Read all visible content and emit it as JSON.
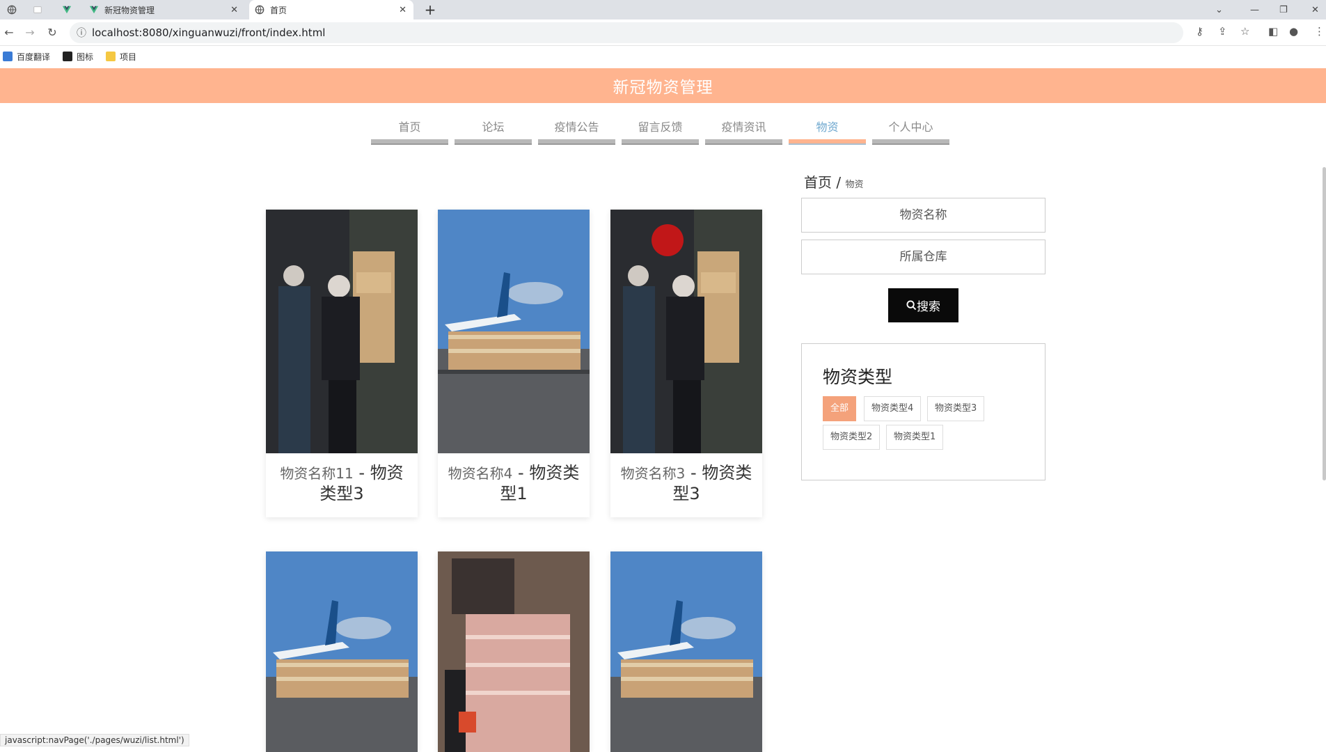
{
  "browser": {
    "tabs": [
      {
        "title": "",
        "active": false
      },
      {
        "title": "",
        "active": false
      },
      {
        "title": "新冠物资管理",
        "active": false
      },
      {
        "title": "首页",
        "active": true
      }
    ],
    "new_tab_symbol": "+",
    "url": "localhost:8080/xinguanwuzi/front/index.html",
    "bookmarks": [
      {
        "label": "百度翻译",
        "icon": "translate-icon",
        "color": "#3a7bd5"
      },
      {
        "label": "图标",
        "icon": "image-icon",
        "color": "#222222"
      },
      {
        "label": "项目",
        "icon": "folder-icon",
        "color": "#f5c842"
      }
    ],
    "status_link": "javascript:navPage('./pages/wuzi/list.html')"
  },
  "site": {
    "title": "新冠物资管理",
    "header_color": "#ffb48f",
    "nav": [
      {
        "label": "首页",
        "active": false
      },
      {
        "label": "论坛",
        "active": false
      },
      {
        "label": "疫情公告",
        "active": false
      },
      {
        "label": "留言反馈",
        "active": false
      },
      {
        "label": "疫情资讯",
        "active": false
      },
      {
        "label": "物资",
        "active": true
      },
      {
        "label": "个人中心",
        "active": false
      }
    ]
  },
  "products": [
    {
      "name": "物资名称11",
      "sep": " - ",
      "type": "物资类型3",
      "image": "warehouse-workers-photo"
    },
    {
      "name": "物资名称4",
      "sep": " - ",
      "type": "物资类型1",
      "image": "airplane-cargo-photo"
    },
    {
      "name": "物资名称3",
      "sep": " - ",
      "type": "物资类型3",
      "image": "warehouse-workers-photo"
    },
    {
      "name": "",
      "sep": "",
      "type": "",
      "image": "airplane-cargo-photo"
    },
    {
      "name": "",
      "sep": "",
      "type": "",
      "image": "stacked-boxes-photo"
    },
    {
      "name": "",
      "sep": "",
      "type": "",
      "image": "airplane-cargo-photo"
    }
  ],
  "sidebar": {
    "breadcrumb_home": "首页",
    "breadcrumb_sep": " / ",
    "breadcrumb_current": "物资",
    "search_name_placeholder": "物资名称",
    "search_warehouse_placeholder": "所属仓库",
    "search_button": "搜索",
    "category_title": "物资类型",
    "categories": [
      {
        "label": "全部",
        "active": true
      },
      {
        "label": "物资类型4",
        "active": false
      },
      {
        "label": "物资类型3",
        "active": false
      },
      {
        "label": "物资类型2",
        "active": false
      },
      {
        "label": "物资类型1",
        "active": false
      }
    ]
  }
}
